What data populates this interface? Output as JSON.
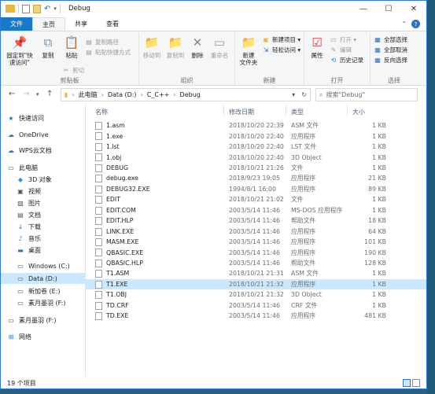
{
  "window": {
    "title": "Debug",
    "controls": {
      "minimize": "—",
      "maximize": "☐",
      "close": "✕"
    }
  },
  "ribbon_tabs": {
    "file": "文件",
    "home": "主页",
    "share": "共享",
    "view": "查看"
  },
  "ribbon": {
    "clipboard": {
      "pin": "固定到\"快\n速访问\"",
      "copy": "复制",
      "paste": "粘贴",
      "cut": "剪切",
      "copy_path": "复制路径",
      "paste_shortcut": "粘贴快捷方式",
      "label": "剪贴板"
    },
    "organize": {
      "move_to": "移动到",
      "copy_to": "复制到",
      "delete": "删除",
      "rename": "重命名",
      "label": "组织"
    },
    "new": {
      "new_folder": "新建\n文件夹",
      "new_item": "新建项目 ▾",
      "easy_access": "轻松访问 ▾",
      "label": "新建"
    },
    "open": {
      "properties": "属性",
      "open": "打开 ▾",
      "edit": "编辑",
      "history": "历史记录",
      "label": "打开"
    },
    "select": {
      "select_all": "全部选择",
      "select_none": "全部取消",
      "invert": "反向选择",
      "label": "选择"
    }
  },
  "address": {
    "crumbs": [
      "此电脑",
      "Data (D:)",
      "C_C++",
      "Debug"
    ],
    "search_placeholder": "搜索\"Debug\""
  },
  "sidebar": [
    {
      "label": "快速访问",
      "icon": "star-icon",
      "color": "#2a73c8"
    },
    {
      "label": "OneDrive",
      "icon": "cloud-icon",
      "color": "#2a73c8"
    },
    {
      "label": "WPS云文档",
      "icon": "cloud-icon",
      "color": "#2a73c8"
    },
    {
      "label": "此电脑",
      "icon": "computer-icon",
      "color": "#2a73c8"
    },
    {
      "label": "3D 对象",
      "icon": "cube-icon",
      "color": "#3a8ed8"
    },
    {
      "label": "视频",
      "icon": "video-icon",
      "color": "#555555"
    },
    {
      "label": "图片",
      "icon": "picture-icon",
      "color": "#555555"
    },
    {
      "label": "文档",
      "icon": "document-icon",
      "color": "#555555"
    },
    {
      "label": "下载",
      "icon": "download-icon",
      "color": "#2a73c8"
    },
    {
      "label": "音乐",
      "icon": "music-icon",
      "color": "#2a73c8"
    },
    {
      "label": "桌面",
      "icon": "desktop-icon",
      "color": "#2a73c8"
    },
    {
      "label": "Windows (C:)",
      "icon": "drive-icon",
      "color": "#555555"
    },
    {
      "label": "Data (D:)",
      "icon": "drive-icon",
      "color": "#555555"
    },
    {
      "label": "新加卷 (E:)",
      "icon": "drive-icon",
      "color": "#555555"
    },
    {
      "label": "素月墨羽 (F:)",
      "icon": "drive-icon",
      "color": "#555555"
    },
    {
      "label": "素月墨羽 (F:)",
      "icon": "drive-icon",
      "color": "#555555"
    },
    {
      "label": "网络",
      "icon": "network-icon",
      "color": "#2a73c8"
    }
  ],
  "columns": {
    "name": "名称",
    "date": "修改日期",
    "type": "类型",
    "size": "大小"
  },
  "files": [
    {
      "name": "1.asm",
      "date": "2018/10/20 22:39",
      "type": "ASM 文件",
      "size": "1 KB"
    },
    {
      "name": "1.exe",
      "date": "2018/10/20 22:40",
      "type": "应用程序",
      "size": "1 KB"
    },
    {
      "name": "1.lst",
      "date": "2018/10/20 22:40",
      "type": "LST 文件",
      "size": "1 KB"
    },
    {
      "name": "1.obj",
      "date": "2018/10/20 22:40",
      "type": "3D Object",
      "size": "1 KB"
    },
    {
      "name": "DEBUG",
      "date": "2018/10/21 21:26",
      "type": "文件",
      "size": "1 KB"
    },
    {
      "name": "debug.exe",
      "date": "2018/9/23 19:05",
      "type": "应用程序",
      "size": "21 KB"
    },
    {
      "name": "DEBUG32.EXE",
      "date": "1994/8/1 16:00",
      "type": "应用程序",
      "size": "89 KB"
    },
    {
      "name": "EDIT",
      "date": "2018/10/21 21:02",
      "type": "文件",
      "size": "1 KB"
    },
    {
      "name": "EDIT.COM",
      "date": "2003/5/14 11:46",
      "type": "MS-DOS 应用程序",
      "size": "1 KB"
    },
    {
      "name": "EDIT.HLP",
      "date": "2003/5/14 11:46",
      "type": "帮助文件",
      "size": "18 KB"
    },
    {
      "name": "LINK.EXE",
      "date": "2003/5/14 11:46",
      "type": "应用程序",
      "size": "64 KB"
    },
    {
      "name": "MASM.EXE",
      "date": "2003/5/14 11:46",
      "type": "应用程序",
      "size": "101 KB"
    },
    {
      "name": "QBASIC.EXE",
      "date": "2003/5/14 11:46",
      "type": "应用程序",
      "size": "190 KB"
    },
    {
      "name": "QBASIC.HLP",
      "date": "2003/5/14 11:46",
      "type": "帮助文件",
      "size": "128 KB"
    },
    {
      "name": "T1.ASM",
      "date": "2018/10/21 21:31",
      "type": "ASM 文件",
      "size": "1 KB"
    },
    {
      "name": "T1.EXE",
      "date": "2018/10/21 21:32",
      "type": "应用程序",
      "size": "1 KB"
    },
    {
      "name": "T1.OBJ",
      "date": "2018/10/21 21:32",
      "type": "3D Object",
      "size": "1 KB"
    },
    {
      "name": "TD.CRF",
      "date": "2003/5/14 11:46",
      "type": "CRF 文件",
      "size": "1 KB"
    },
    {
      "name": "TD.EXE",
      "date": "2003/5/14 11:46",
      "type": "应用程序",
      "size": "481 KB"
    }
  ],
  "status": {
    "count": "19 个项目"
  },
  "colors": {
    "accent": "#1979ca",
    "selection": "#cce8ff"
  }
}
